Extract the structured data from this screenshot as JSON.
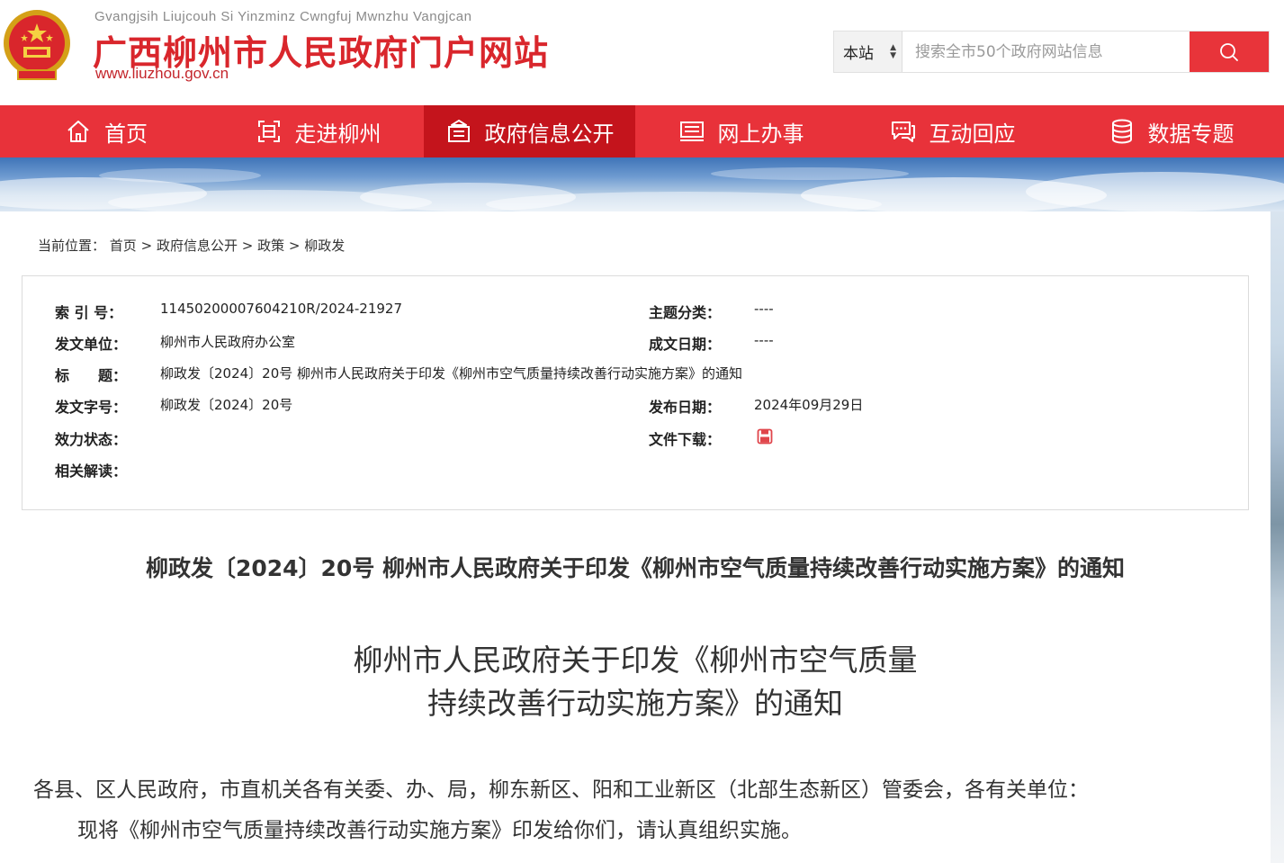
{
  "header": {
    "latin_name": "Gvangjsih Liujcouh Si Yinzminz Cwngfuj Mwnzhu Vangjcan",
    "site_title": "广西柳州市人民政府门户网站",
    "site_url": "www.liuzhou.gov.cn",
    "search": {
      "scope": "本站",
      "placeholder": "搜索全市50个政府网站信息"
    }
  },
  "nav": {
    "items": [
      {
        "label": "首页",
        "icon": "home-icon"
      },
      {
        "label": "走进柳州",
        "icon": "scan-icon"
      },
      {
        "label": "政府信息公开",
        "icon": "building-icon",
        "active": true
      },
      {
        "label": "网上办事",
        "icon": "computer-icon"
      },
      {
        "label": "互动回应",
        "icon": "chat-icon"
      },
      {
        "label": "数据专题",
        "icon": "database-icon"
      }
    ]
  },
  "breadcrumb": {
    "prefix": "当前位置：",
    "items": [
      "首页",
      "政府信息公开",
      "政策",
      "柳政发"
    ],
    "separator": ">"
  },
  "info": {
    "index_label": "索 引 号：",
    "index_value": "11450200007604210R/2024-21927",
    "issuer_label": "发文单位：",
    "issuer_value": "柳州市人民政府办公室",
    "title_label": "标　　题：",
    "title_value": "柳政发〔2024〕20号 柳州市人民政府关于印发《柳州市空气质量持续改善行动实施方案》的通知",
    "docno_label": "发文字号：",
    "docno_value": "柳政发〔2024〕20号",
    "status_label": "效力状态：",
    "related_label": "相关解读：",
    "topic_label": "主题分类：",
    "topic_value": "----",
    "created_label": "成文日期：",
    "created_value": "----",
    "published_label": "发布日期：",
    "published_value": "2024年09月29日",
    "download_label": "文件下载："
  },
  "document": {
    "title": "柳政发〔2024〕20号 柳州市人民政府关于印发《柳州市空气质量持续改善行动实施方案》的通知",
    "subtitle_line1": "柳州市人民政府关于印发《柳州市空气质量",
    "subtitle_line2": "持续改善行动实施方案》的通知",
    "para1": "各县、区人民政府，市直机关各有关委、办、局，柳东新区、阳和工业新区（北部生态新区）管委会，各有关单位：",
    "para2": "现将《柳州市空气质量持续改善行动实施方案》印发给你们，请认真组织实施。"
  },
  "colors": {
    "brand_red": "#e8323a",
    "nav_active": "#c4141c",
    "title_red": "#d9262c"
  }
}
